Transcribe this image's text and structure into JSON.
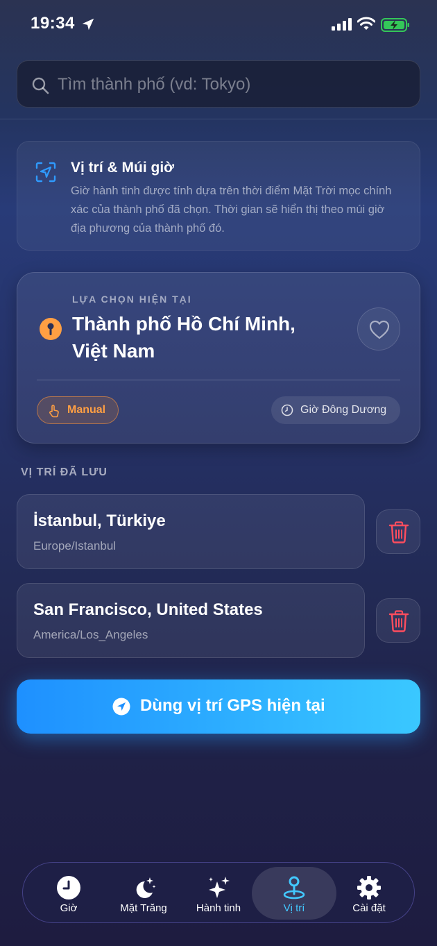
{
  "status_bar": {
    "time": "19:34"
  },
  "search": {
    "placeholder": "Tìm thành phố (vd: Tokyo)",
    "value": ""
  },
  "info_card": {
    "title": "Vị trí & Múi giờ",
    "description": "Giờ hành tinh được tính dựa trên thời điểm Mặt Trời mọc chính xác của thành phố đã chọn. Thời gian sẽ hiển thị theo múi giờ địa phương của thành phố đó."
  },
  "current": {
    "label": "LỰA CHỌN HIỆN TẠI",
    "city": "Thành phố Hồ Chí Minh, Việt Nam",
    "mode_badge": "Manual",
    "timezone_badge": "Giờ Đông Dương"
  },
  "saved": {
    "heading": "VỊ TRÍ ĐÃ LƯU",
    "items": [
      {
        "name": "İstanbul, Türkiye",
        "timezone": "Europe/Istanbul"
      },
      {
        "name": "San Francisco, United States",
        "timezone": "America/Los_Angeles"
      }
    ]
  },
  "gps_button": {
    "label": "Dùng vị trí GPS hiện tại"
  },
  "tabs": [
    {
      "label": "Giờ",
      "icon": "clock-icon",
      "active": false
    },
    {
      "label": "Mặt Trăng",
      "icon": "moon-stars-icon",
      "active": false
    },
    {
      "label": "Hành tinh",
      "icon": "sparkles-icon",
      "active": false
    },
    {
      "label": "Vị trí",
      "icon": "map-pin-icon",
      "active": true
    },
    {
      "label": "Cài đặt",
      "icon": "gear-icon",
      "active": false
    }
  ],
  "colors": {
    "accent_orange": "#ff9f43",
    "accent_blue": "#42c8ff",
    "delete_red": "#ff4d5e",
    "gps_button_start": "#1e90ff",
    "gps_button_end": "#3ac8ff",
    "battery_green": "#34c759"
  }
}
